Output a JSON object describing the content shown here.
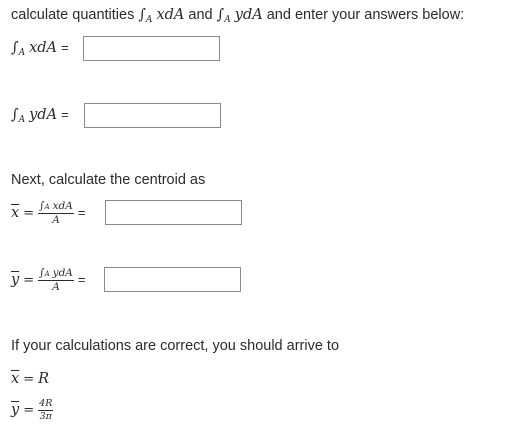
{
  "instructions": {
    "prefix": "calculate quantities",
    "and": "and",
    "suffix": "and enter your answers below:"
  },
  "math": {
    "integral": "∫",
    "region": "A",
    "x_dA": "xdA",
    "y_dA": "ydA",
    "x": "x",
    "y": "y",
    "equals": "=",
    "den_A": "A",
    "result_R": "R",
    "result_num": "4R",
    "result_den": "3π"
  },
  "fields": {
    "int_x_dA_value": "",
    "int_y_dA_value": "",
    "x_bar_value": "",
    "y_bar_value": ""
  },
  "next_text": "Next, calculate the centroid as",
  "result_text": "If your calculations are correct, you should arrive to"
}
